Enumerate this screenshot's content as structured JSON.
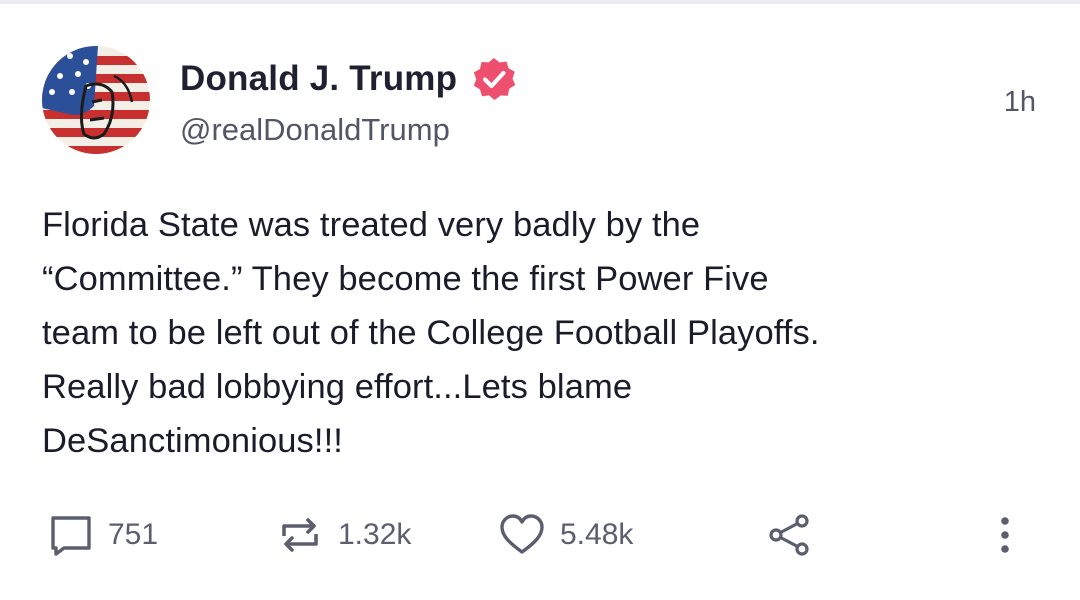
{
  "author": {
    "display_name": "Donald J. Trump",
    "handle": "@realDonaldTrump",
    "verified": true,
    "avatar_icon": "stars-and-stripes-portrait"
  },
  "timestamp": "1h",
  "post": {
    "lines": [
      "Florida State was treated very badly by the",
      "“Committee.” They become the first Power Five",
      "team to be left out of the College Football Playoffs.",
      "Really bad lobbying effort...Lets blame",
      "DeSanctimonious!!!"
    ]
  },
  "actions": {
    "replies": "751",
    "reposts": "1.32k",
    "likes": "5.48k",
    "share_icon": "share-icon",
    "more_icon": "more-vertical-icon"
  },
  "colors": {
    "verified_badge": "#ef4f6e",
    "text": "#1a1c2a",
    "secondary_text": "#535668",
    "icon": "#5b5e6e"
  }
}
